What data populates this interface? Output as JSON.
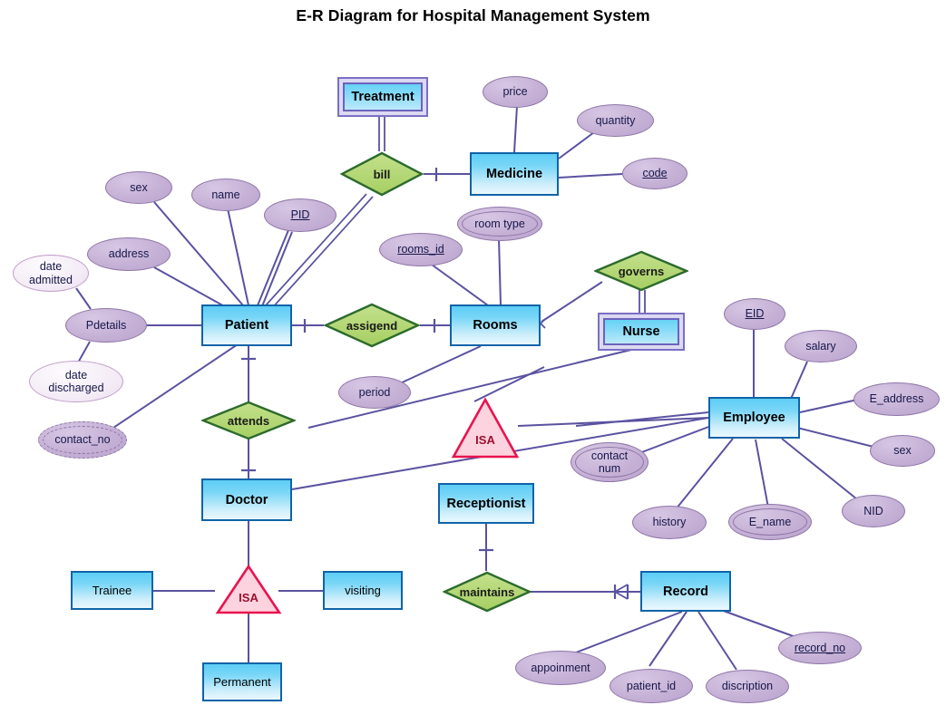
{
  "title": "E-R Diagram for Hospital Management System",
  "colors": {
    "entity_border": "#1063a8",
    "entity_fill_top": "#5ecdf5",
    "entity_fill_bottom": "#eaf8fe",
    "weak_entity_border": "#7b6fc4",
    "relationship_fill": "#b5d878",
    "relationship_border": "#2c6b2c",
    "attribute_fill": "#c6b1d6",
    "attribute_border": "#8e75a8",
    "attribute_text": "#16174a",
    "isa_fill": "#fcd3de",
    "isa_border": "#e8134f",
    "isa_text": "#9c1030",
    "connector": "#5a52a0",
    "background": "#ffffff"
  },
  "entities": [
    {
      "id": "treatment",
      "label": "Treatment",
      "kind": "weak"
    },
    {
      "id": "medicine",
      "label": "Medicine",
      "kind": "strong"
    },
    {
      "id": "patient",
      "label": "Patient",
      "kind": "strong"
    },
    {
      "id": "rooms",
      "label": "Rooms",
      "kind": "strong"
    },
    {
      "id": "nurse",
      "label": "Nurse",
      "kind": "weak"
    },
    {
      "id": "employee",
      "label": "Employee",
      "kind": "strong"
    },
    {
      "id": "doctor",
      "label": "Doctor",
      "kind": "strong"
    },
    {
      "id": "receptionist",
      "label": "Receptionist",
      "kind": "strong"
    },
    {
      "id": "record",
      "label": "Record",
      "kind": "strong"
    },
    {
      "id": "trainee",
      "label": "Trainee",
      "kind": "subclass"
    },
    {
      "id": "visiting",
      "label": "visiting",
      "kind": "subclass"
    },
    {
      "id": "permanent",
      "label": "Permanent",
      "kind": "subclass"
    }
  ],
  "relationships": [
    {
      "id": "bill",
      "label": "bill"
    },
    {
      "id": "assigend",
      "label": "assigend"
    },
    {
      "id": "governs",
      "label": "governs"
    },
    {
      "id": "attends",
      "label": "attends"
    },
    {
      "id": "maintains",
      "label": "maintains"
    }
  ],
  "isa_nodes": [
    {
      "id": "isa-receptionist",
      "label": "ISA"
    },
    {
      "id": "isa-doctor",
      "label": "ISA"
    }
  ],
  "attributes": [
    {
      "id": "price",
      "label": "price",
      "owner": "medicine",
      "key": false,
      "multivalued": false,
      "pale": false
    },
    {
      "id": "quantity",
      "label": "quantity",
      "owner": "medicine",
      "key": false,
      "multivalued": false,
      "pale": false
    },
    {
      "id": "code",
      "label": "code",
      "owner": "medicine",
      "key": true,
      "multivalued": false,
      "pale": false
    },
    {
      "id": "sex-patient",
      "label": "sex",
      "owner": "patient",
      "key": false,
      "multivalued": false,
      "pale": false
    },
    {
      "id": "name",
      "label": "name",
      "owner": "patient",
      "key": false,
      "multivalued": false,
      "pale": false
    },
    {
      "id": "pid",
      "label": "PID",
      "owner": "patient",
      "key": true,
      "multivalued": false,
      "pale": false
    },
    {
      "id": "address",
      "label": "address",
      "owner": "patient",
      "key": false,
      "multivalued": false,
      "pale": false
    },
    {
      "id": "pdetails",
      "label": "Pdetails",
      "owner": "patient",
      "key": false,
      "multivalued": false,
      "pale": false
    },
    {
      "id": "date-admitted",
      "label": "date admitted",
      "owner": "pdetails",
      "key": false,
      "multivalued": false,
      "pale": true
    },
    {
      "id": "date-discharged",
      "label": "date discharged",
      "owner": "pdetails",
      "key": false,
      "multivalued": false,
      "pale": true
    },
    {
      "id": "contact-no",
      "label": "contact_no",
      "owner": "patient",
      "key": false,
      "multivalued": true,
      "pale": false
    },
    {
      "id": "rooms-id",
      "label": "rooms_id",
      "owner": "rooms",
      "key": true,
      "multivalued": false,
      "pale": false
    },
    {
      "id": "room-type",
      "label": "room type",
      "owner": "rooms",
      "key": false,
      "multivalued": true,
      "pale": false
    },
    {
      "id": "period",
      "label": "period",
      "owner": "rooms",
      "key": false,
      "multivalued": false,
      "pale": false
    },
    {
      "id": "eid",
      "label": "EID",
      "owner": "employee",
      "key": true,
      "multivalued": false,
      "pale": false
    },
    {
      "id": "salary",
      "label": "salary",
      "owner": "employee",
      "key": false,
      "multivalued": false,
      "pale": false
    },
    {
      "id": "e-address",
      "label": "E_address",
      "owner": "employee",
      "key": false,
      "multivalued": false,
      "pale": false
    },
    {
      "id": "sex-employee",
      "label": "sex",
      "owner": "employee",
      "key": false,
      "multivalued": false,
      "pale": false
    },
    {
      "id": "nid",
      "label": "NID",
      "owner": "employee",
      "key": false,
      "multivalued": false,
      "pale": false
    },
    {
      "id": "contact-num",
      "label": "contact num",
      "owner": "employee",
      "key": false,
      "multivalued": true,
      "pale": false
    },
    {
      "id": "history",
      "label": "history",
      "owner": "employee",
      "key": false,
      "multivalued": false,
      "pale": false
    },
    {
      "id": "e-name",
      "label": "E_name",
      "owner": "employee",
      "key": false,
      "multivalued": true,
      "pale": false
    },
    {
      "id": "appoinment",
      "label": "appoinment",
      "owner": "record",
      "key": false,
      "multivalued": false,
      "pale": false
    },
    {
      "id": "patient-id",
      "label": "patient_id",
      "owner": "record",
      "key": false,
      "multivalued": false,
      "pale": false
    },
    {
      "id": "discription",
      "label": "discription",
      "owner": "record",
      "key": false,
      "multivalued": false,
      "pale": false
    },
    {
      "id": "record-no",
      "label": "record_no",
      "owner": "record",
      "key": true,
      "multivalued": false,
      "pale": false
    }
  ],
  "labels": {
    "treatment": "Treatment",
    "medicine": "Medicine",
    "patient": "Patient",
    "rooms": "Rooms",
    "nurse": "Nurse",
    "employee": "Employee",
    "doctor": "Doctor",
    "receptionist": "Receptionist",
    "record": "Record",
    "trainee": "Trainee",
    "visiting": "visiting",
    "permanent": "Permanent",
    "bill": "bill",
    "assigend": "assigend",
    "governs": "governs",
    "attends": "attends",
    "maintains": "maintains",
    "isa": "ISA",
    "price": "price",
    "quantity": "quantity",
    "code": "code",
    "sex_patient": "sex",
    "name": "name",
    "pid": "PID",
    "address": "address",
    "pdetails": "Pdetails",
    "date_admitted_line1": "date",
    "date_admitted_line2": "admitted",
    "date_discharged_line1": "date",
    "date_discharged_line2": "discharged",
    "contact_no": "contact_no",
    "rooms_id": "rooms_id",
    "room_type": "room type",
    "period": "period",
    "eid": "EID",
    "salary": "salary",
    "e_address": "E_address",
    "sex_employee": "sex",
    "nid": "NID",
    "contact_num_line1": "contact",
    "contact_num_line2": "num",
    "history": "history",
    "e_name": "E_name",
    "appoinment": "appoinment",
    "patient_id": "patient_id",
    "discription": "discription",
    "record_no": "record_no"
  }
}
